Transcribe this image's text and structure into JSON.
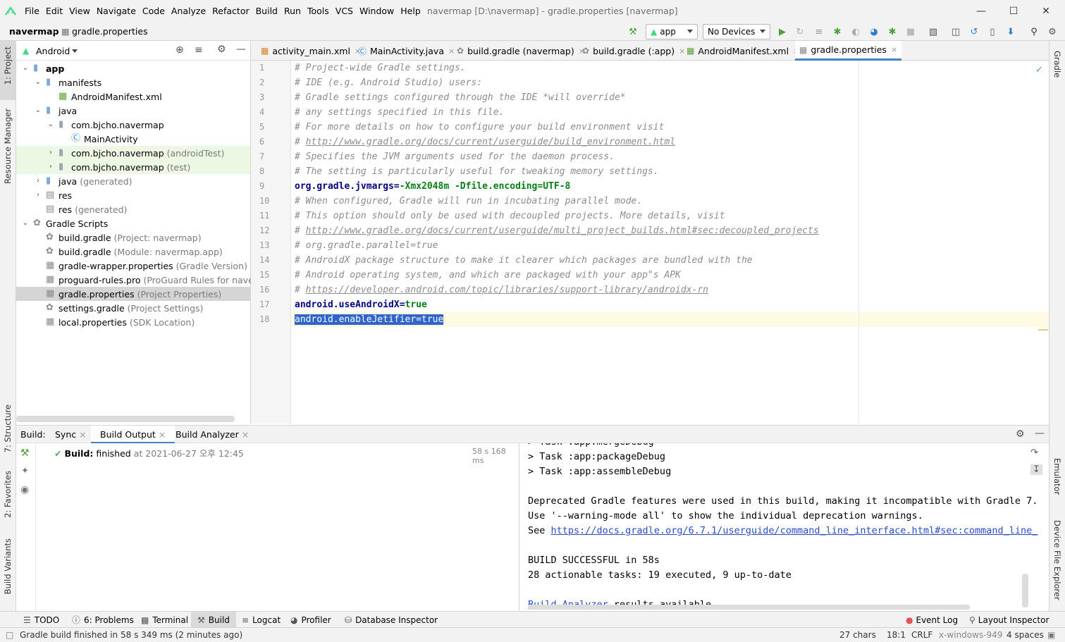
{
  "menubar": {
    "items": [
      "File",
      "Edit",
      "View",
      "Navigate",
      "Code",
      "Analyze",
      "Refactor",
      "Build",
      "Run",
      "Tools",
      "VCS",
      "Window",
      "Help"
    ],
    "window_title": "navermap [D:\\navermap] - gradle.properties [navermap]"
  },
  "navbar": {
    "project": "navermap",
    "file": "gradle.properties",
    "run_config": "app",
    "device": "No Devices"
  },
  "left_stripe": {
    "project_tab": "1: Project",
    "resource_manager": "Resource Manager",
    "structure": "7: Structure",
    "favorites": "2: Favorites",
    "build_variants": "Build Variants"
  },
  "right_stripe": {
    "gradle": "Gradle",
    "emulator": "Emulator",
    "device_file_explorer": "Device File Explorer"
  },
  "project_panel": {
    "view_mode": "Android",
    "tree": [
      {
        "label": "app",
        "extra": ""
      },
      {
        "label": "manifests",
        "extra": ""
      },
      {
        "label": "AndroidManifest.xml",
        "extra": ""
      },
      {
        "label": "java",
        "extra": ""
      },
      {
        "label": "com.bjcho.navermap",
        "extra": ""
      },
      {
        "label": "MainActivity",
        "extra": ""
      },
      {
        "label": "com.bjcho.navermap",
        "extra": "(androidTest)"
      },
      {
        "label": "com.bjcho.navermap",
        "extra": "(test)"
      },
      {
        "label": "java",
        "extra": "(generated)"
      },
      {
        "label": "res",
        "extra": ""
      },
      {
        "label": "res",
        "extra": "(generated)"
      },
      {
        "label": "Gradle Scripts",
        "extra": ""
      },
      {
        "label": "build.gradle",
        "extra": "(Project: navermap)"
      },
      {
        "label": "build.gradle",
        "extra": "(Module: navermap.app)"
      },
      {
        "label": "gradle-wrapper.properties",
        "extra": "(Gradle Version)"
      },
      {
        "label": "proguard-rules.pro",
        "extra": "(ProGuard Rules for navermap.a"
      },
      {
        "label": "gradle.properties",
        "extra": "(Project Properties)"
      },
      {
        "label": "settings.gradle",
        "extra": "(Project Settings)"
      },
      {
        "label": "local.properties",
        "extra": "(SDK Location)"
      }
    ]
  },
  "editor_tabs": [
    "activity_main.xml",
    "MainActivity.java",
    "build.gradle (navermap)",
    "build.gradle (:app)",
    "AndroidManifest.xml",
    "gradle.properties"
  ],
  "editor": {
    "lines": [
      {
        "n": "1",
        "type": "comment",
        "text": "# Project-wide Gradle settings."
      },
      {
        "n": "2",
        "type": "comment",
        "text": "# IDE (e.g. Android Studio) users:"
      },
      {
        "n": "3",
        "type": "comment",
        "text": "# Gradle settings configured through the IDE *will override*"
      },
      {
        "n": "4",
        "type": "comment",
        "text": "# any settings specified in this file."
      },
      {
        "n": "5",
        "type": "comment",
        "text": "# For more details on how to configure your build environment visit"
      },
      {
        "n": "6",
        "type": "comment",
        "text": "# ",
        "link": "http://www.gradle.org/docs/current/userguide/build_environment.html"
      },
      {
        "n": "7",
        "type": "comment",
        "text": "# Specifies the JVM arguments used for the daemon process."
      },
      {
        "n": "8",
        "type": "comment",
        "text": "# The setting is particularly useful for tweaking memory settings."
      },
      {
        "n": "9",
        "type": "prop",
        "key": "org.gradle.jvmargs",
        "value": "-Xmx2048m -Dfile.encoding=UTF-8"
      },
      {
        "n": "10",
        "type": "comment",
        "text": "# When configured, Gradle will run in incubating parallel mode."
      },
      {
        "n": "11",
        "type": "comment",
        "text": "# This option should only be used with decoupled projects. More details, visit"
      },
      {
        "n": "12",
        "type": "comment",
        "text": "# ",
        "link": "http://www.gradle.org/docs/current/userguide/multi_project_builds.html#sec:decoupled_projects"
      },
      {
        "n": "13",
        "type": "comment",
        "text": "# org.gradle.parallel=true"
      },
      {
        "n": "14",
        "type": "comment",
        "text": "# AndroidX package structure to make it clearer which packages are bundled with the"
      },
      {
        "n": "15",
        "type": "comment",
        "text": "# Android operating system, and which are packaged with your app\"s APK"
      },
      {
        "n": "16",
        "type": "comment",
        "text": "# ",
        "link": "https://developer.android.com/topic/libraries/support-library/androidx-rn"
      },
      {
        "n": "17",
        "type": "prop",
        "key": "android.useAndroidX",
        "value": "true"
      },
      {
        "n": "18",
        "type": "selected",
        "text": "android.enableJetifier=true"
      }
    ]
  },
  "build_panel": {
    "label": "Build:",
    "tabs": [
      "Sync",
      "Build Output",
      "Build Analyzer"
    ],
    "status_title": "Build:",
    "status_text": "finished",
    "status_time": "at 2021-06-27 오후 12:45",
    "duration": "58 s 168 ms",
    "output_lines": [
      "> Task :app:mergeDebug",
      "> Task :app:packageDebug",
      "> Task :app:assembleDebug",
      "",
      "Deprecated Gradle features were used in this build, making it incompatible with Gradle 7.",
      "Use '--warning-mode all' to show the individual deprecation warnings.",
      "See ",
      "",
      "BUILD SUCCESSFUL in 58s",
      "28 actionable tasks: 19 executed, 9 up-to-date",
      "",
      ""
    ],
    "see_link": "https://docs.gradle.org/6.7.1/userguide/command_line_interface.html#sec:command_line_",
    "analyzer_link": "Build Analyzer",
    "analyzer_suffix": " results available"
  },
  "tool_stripe": {
    "todo": "TODO",
    "problems": "6: Problems",
    "terminal": "Terminal",
    "build": "Build",
    "logcat": "Logcat",
    "profiler": "Profiler",
    "database": "Database Inspector",
    "event_log": "Event Log",
    "layout_inspector": "Layout Inspector"
  },
  "status_bar": {
    "message": "Gradle build finished in 58 s 349 ms (2 minutes ago)",
    "chars": "27 chars",
    "position": "18:1",
    "line_sep": "CRLF",
    "encoding": "x-windows-949",
    "indent": "4 spaces"
  },
  "colors": {
    "accent": "#4083c9",
    "selection": "#2f65ca",
    "android_green": "#3ddc84",
    "success": "#59a869"
  }
}
